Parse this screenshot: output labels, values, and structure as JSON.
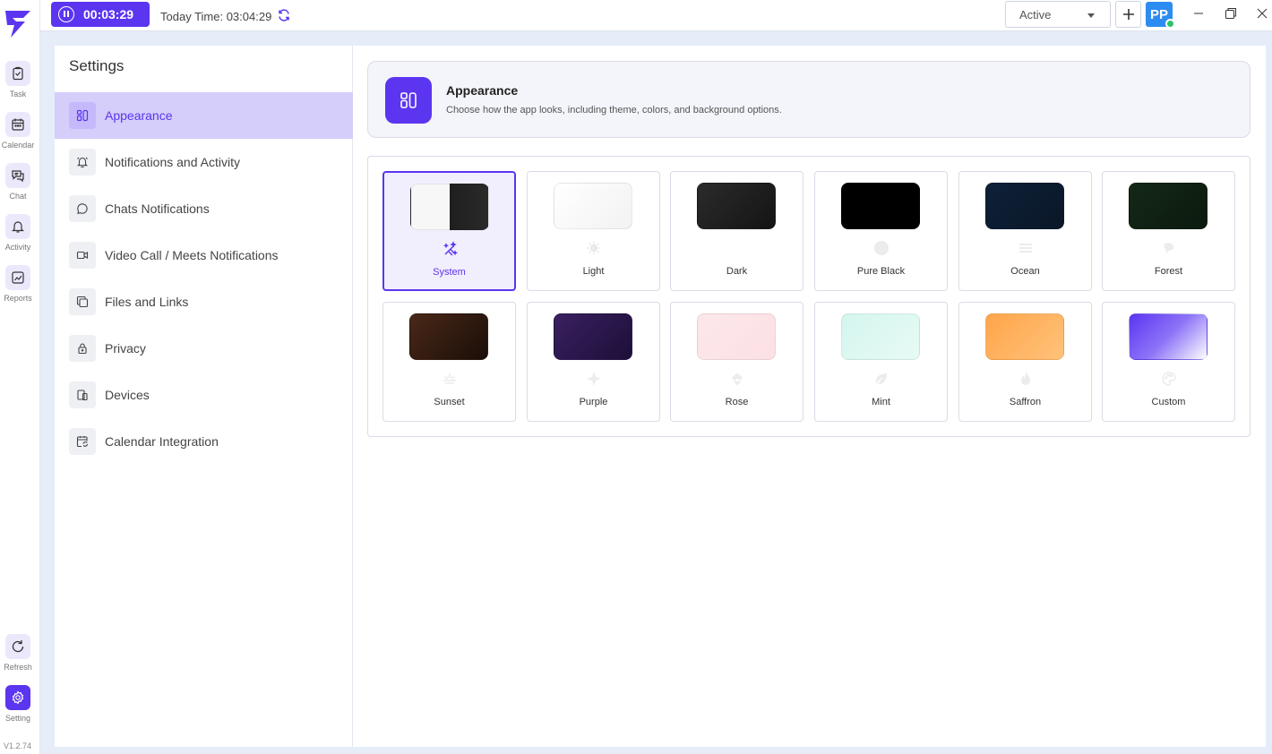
{
  "timer": {
    "elapsed": "00:03:29"
  },
  "today": {
    "label": "Today Time: 03:04:29"
  },
  "status": {
    "value": "Active"
  },
  "user": {
    "initials": "PP"
  },
  "rail": {
    "items": [
      {
        "label": "Task",
        "icon": "task-icon"
      },
      {
        "label": "Calendar",
        "icon": "calendar-icon"
      },
      {
        "label": "Chat",
        "icon": "chat-icon"
      },
      {
        "label": "Activity",
        "icon": "bell-icon"
      },
      {
        "label": "Reports",
        "icon": "reports-icon"
      }
    ],
    "refresh_label": "Refresh",
    "setting_label": "Setting",
    "version": "V1.2.74"
  },
  "settings": {
    "title": "Settings",
    "menu": [
      {
        "label": "Appearance",
        "icon": "appearance-icon",
        "active": true
      },
      {
        "label": "Notifications and Activity",
        "icon": "bell-icon"
      },
      {
        "label": "Chats Notifications",
        "icon": "chat-bubble-icon"
      },
      {
        "label": "Video Call / Meets Notifications",
        "icon": "video-icon"
      },
      {
        "label": "Files and Links",
        "icon": "files-icon"
      },
      {
        "label": "Privacy",
        "icon": "lock-icon"
      },
      {
        "label": "Devices",
        "icon": "devices-icon"
      },
      {
        "label": "Calendar Integration",
        "icon": "calendar-sync-icon"
      }
    ]
  },
  "appearance": {
    "title": "Appearance",
    "description": "Choose how the app looks, including theme, colors, and background options.",
    "themes": [
      {
        "label": "System",
        "icon": "magic-wand-icon",
        "selected": true
      },
      {
        "label": "Light",
        "icon": "sun-icon"
      },
      {
        "label": "Dark",
        "icon": "moon-icon"
      },
      {
        "label": "Pure Black",
        "icon": "circle-icon"
      },
      {
        "label": "Ocean",
        "icon": "waves-icon"
      },
      {
        "label": "Forest",
        "icon": "leaf-icon"
      },
      {
        "label": "Sunset",
        "icon": "sunset-icon"
      },
      {
        "label": "Purple",
        "icon": "sparkle-icon"
      },
      {
        "label": "Rose",
        "icon": "flower-icon"
      },
      {
        "label": "Mint",
        "icon": "mint-leaf-icon"
      },
      {
        "label": "Saffron",
        "icon": "flame-icon"
      },
      {
        "label": "Custom",
        "icon": "palette-icon"
      }
    ]
  },
  "colors": {
    "accent": "#5b35f0"
  }
}
